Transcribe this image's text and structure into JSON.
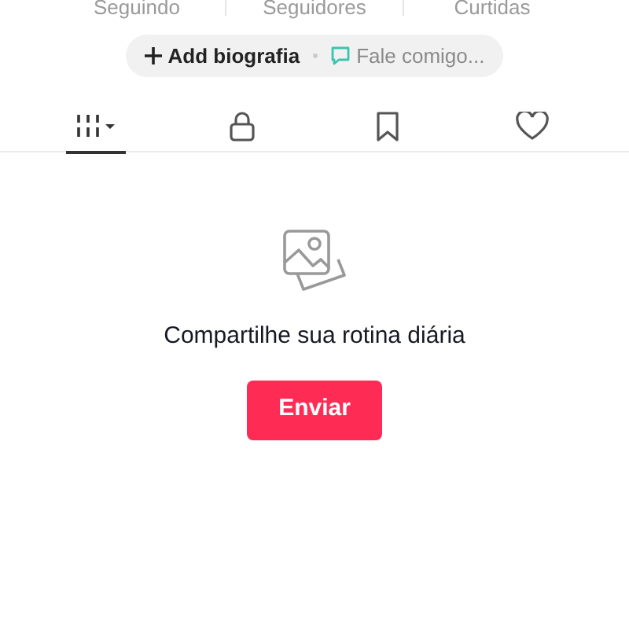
{
  "stats": [
    {
      "label": "Seguindo"
    },
    {
      "label": "Seguidores"
    },
    {
      "label": "Curtidas"
    }
  ],
  "bio_bar": {
    "add_bio": "Add biografia",
    "contact": "Fale comigo..."
  },
  "tabs": [
    {
      "kind": "grid",
      "selected": true
    },
    {
      "kind": "lock",
      "selected": false
    },
    {
      "kind": "bookmark",
      "selected": false
    },
    {
      "kind": "heart",
      "selected": false
    }
  ],
  "empty_state": {
    "message": "Compartilhe sua rotina diária",
    "button": "Enviar"
  }
}
